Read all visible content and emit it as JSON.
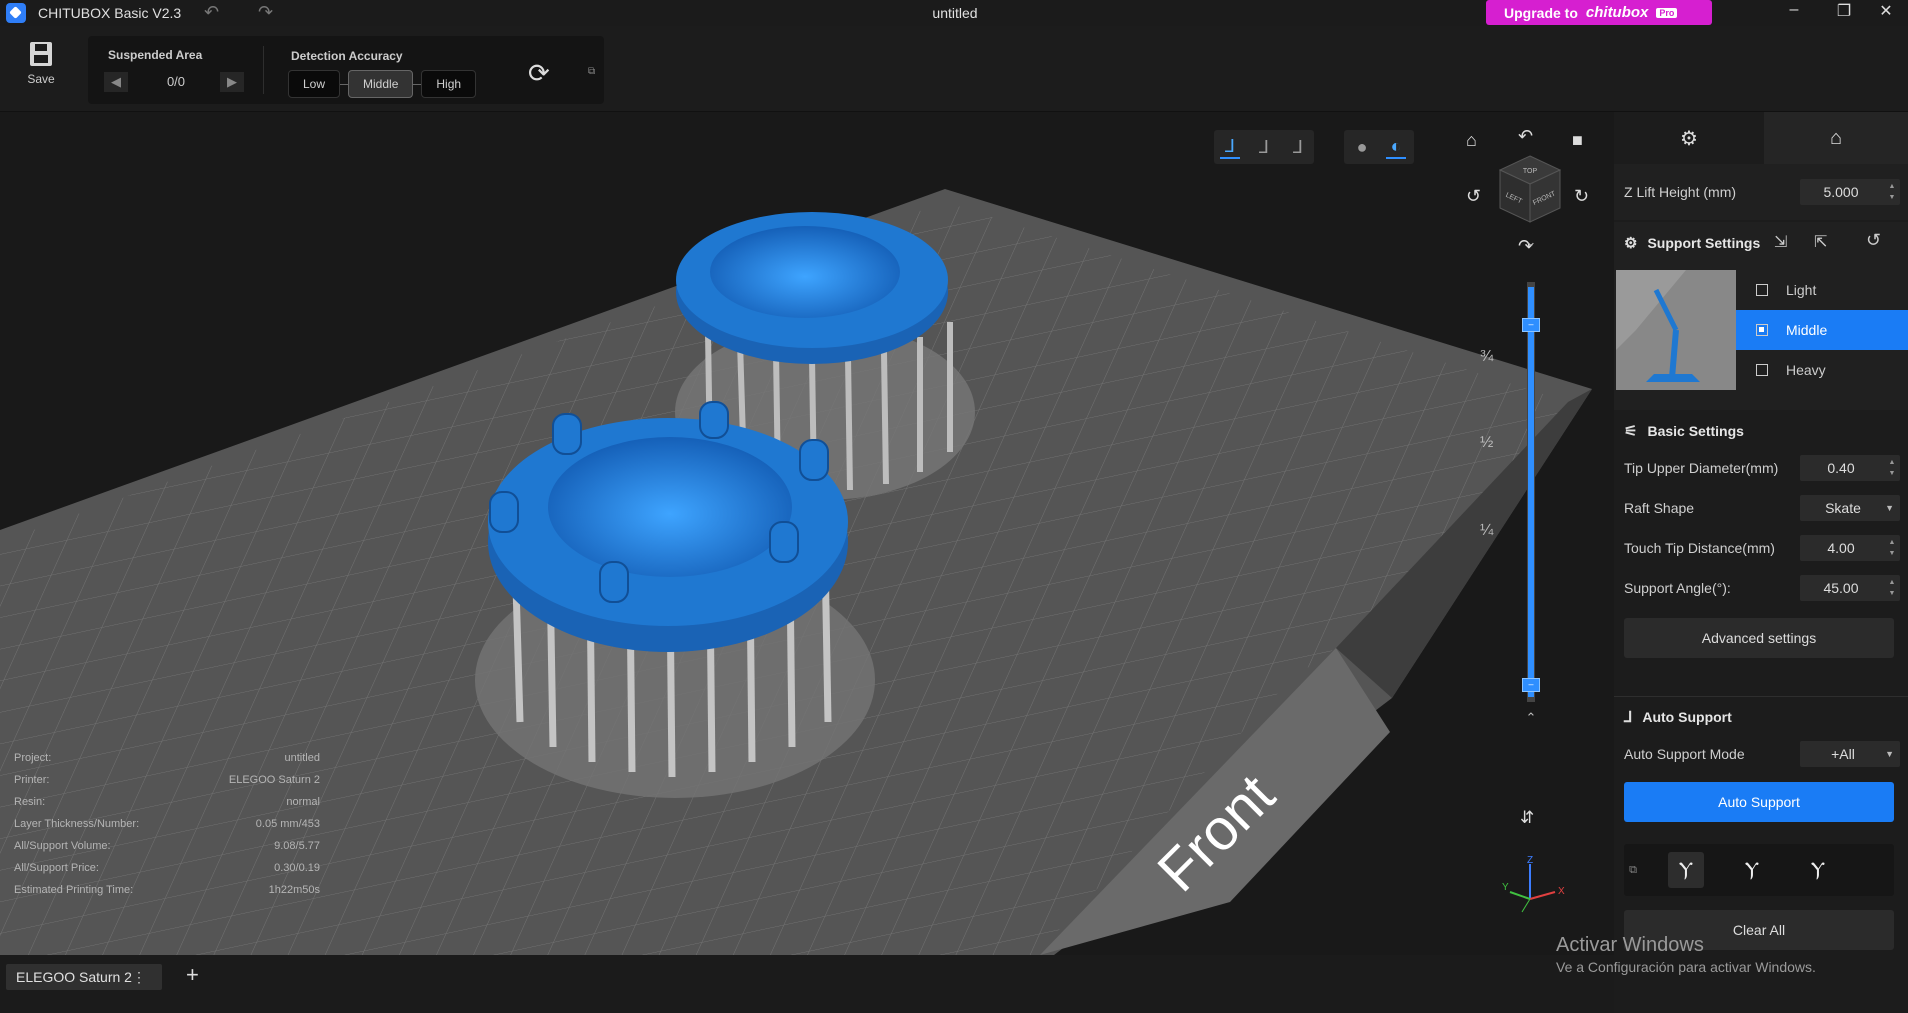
{
  "titlebar": {
    "app_title": "CHITUBOX Basic V2.3",
    "document_title": "untitled",
    "upgrade_label": "Upgrade to",
    "upgrade_brand": "chitubox",
    "upgrade_badge": "Pro"
  },
  "toolbar": {
    "save_label": "Save",
    "suspended_area_title": "Suspended Area",
    "suspended_area_value": "0/0",
    "detection_accuracy_title": "Detection Accuracy",
    "accuracy_options": [
      "Low",
      "Middle",
      "High"
    ],
    "accuracy_selected": "Middle"
  },
  "viewport": {
    "view_modes": [
      "support-view-icon",
      "support-view-2-icon",
      "support-view-3-icon"
    ],
    "render_modes": [
      "solid-sphere-icon",
      "transparent-sphere-icon"
    ],
    "view_cube": {
      "top": "TOP",
      "left": "LEFT",
      "front": "FRONT"
    },
    "layer_fractions": [
      "¾",
      "½",
      "¼"
    ],
    "slider_top": "–",
    "slider_bottom": "–",
    "axes": {
      "x": "X",
      "y": "Y",
      "z": "Z"
    },
    "build_plate_label": "Front"
  },
  "info": [
    {
      "key": "Project:",
      "value": "untitled"
    },
    {
      "key": "Printer:",
      "value": "ELEGOO Saturn 2"
    },
    {
      "key": "Resin:",
      "value": "normal"
    },
    {
      "key": "Layer Thickness/Number:",
      "value": "0.05 mm/453"
    },
    {
      "key": "All/Support Volume:",
      "value": "9.08/5.77"
    },
    {
      "key": "All/Support Price:",
      "value": "0.30/0.19"
    },
    {
      "key": "Estimated Printing Time:",
      "value": "1h22m50s"
    }
  ],
  "tabs": {
    "printer_tab": "ELEGOO Saturn 2",
    "menu_glyph": "⋮",
    "add_glyph": "+"
  },
  "panel": {
    "z_lift_label": "Z Lift Height (mm)",
    "z_lift_value": "5.000",
    "support_settings_title": "Support Settings",
    "presets": [
      "Light",
      "Middle",
      "Heavy"
    ],
    "preset_selected": "Middle",
    "basic_settings_title": "Basic Settings",
    "tip_upper_label": "Tip Upper Diameter(mm)",
    "tip_upper_value": "0.40",
    "raft_shape_label": "Raft Shape",
    "raft_shape_value": "Skate",
    "touch_tip_label": "Touch Tip Distance(mm)",
    "touch_tip_value": "4.00",
    "support_angle_label": "Support Angle(°):",
    "support_angle_value": "45.00",
    "advanced_label": "Advanced settings",
    "auto_support_title": "Auto Support",
    "auto_mode_label": "Auto Support Mode",
    "auto_mode_value": "+All",
    "auto_support_button": "Auto Support",
    "clear_all_label": "Clear All"
  },
  "watermark": {
    "title": "Activar Windows",
    "subtitle": "Ve a Configuración para activar Windows."
  },
  "colors": {
    "accent": "#1a7cf5",
    "model_blue": "#1f78d1",
    "upgrade_magenta": "#d61fd0",
    "plate": "#5e5e5e"
  }
}
